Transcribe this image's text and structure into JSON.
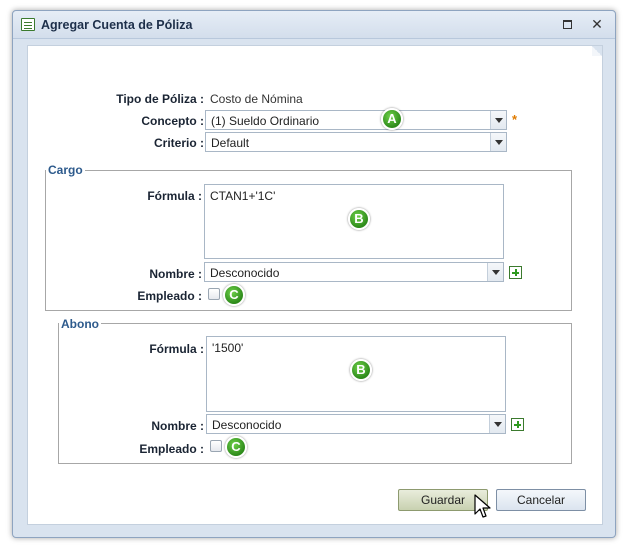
{
  "window": {
    "title": "Agregar Cuenta de Póliza"
  },
  "form": {
    "tipo_poliza_label": "Tipo de Póliza :",
    "tipo_poliza_value": "Costo de Nómina",
    "concepto_label": "Concepto :",
    "concepto_value": "(1) Sueldo Ordinario",
    "required_mark": "*",
    "criterio_label": "Criterio :",
    "criterio_value": "Default"
  },
  "cargo": {
    "legend": "Cargo",
    "formula_label": "Fórmula :",
    "formula_value": "CTAN1+'1C'",
    "nombre_label": "Nombre :",
    "nombre_value": "Desconocido",
    "empleado_label": "Empleado :"
  },
  "abono": {
    "legend": "Abono",
    "formula_label": "Fórmula :",
    "formula_value": "'1500'",
    "nombre_label": "Nombre :",
    "nombre_value": "Desconocido",
    "empleado_label": "Empleado :"
  },
  "markers": {
    "a": "A",
    "b": "B",
    "c": "C"
  },
  "buttons": {
    "save": "Guardar",
    "cancel": "Cancelar"
  },
  "colors": {
    "accent": "#2d5a8c",
    "marker": "#3aa322",
    "required": "#e07b00"
  }
}
